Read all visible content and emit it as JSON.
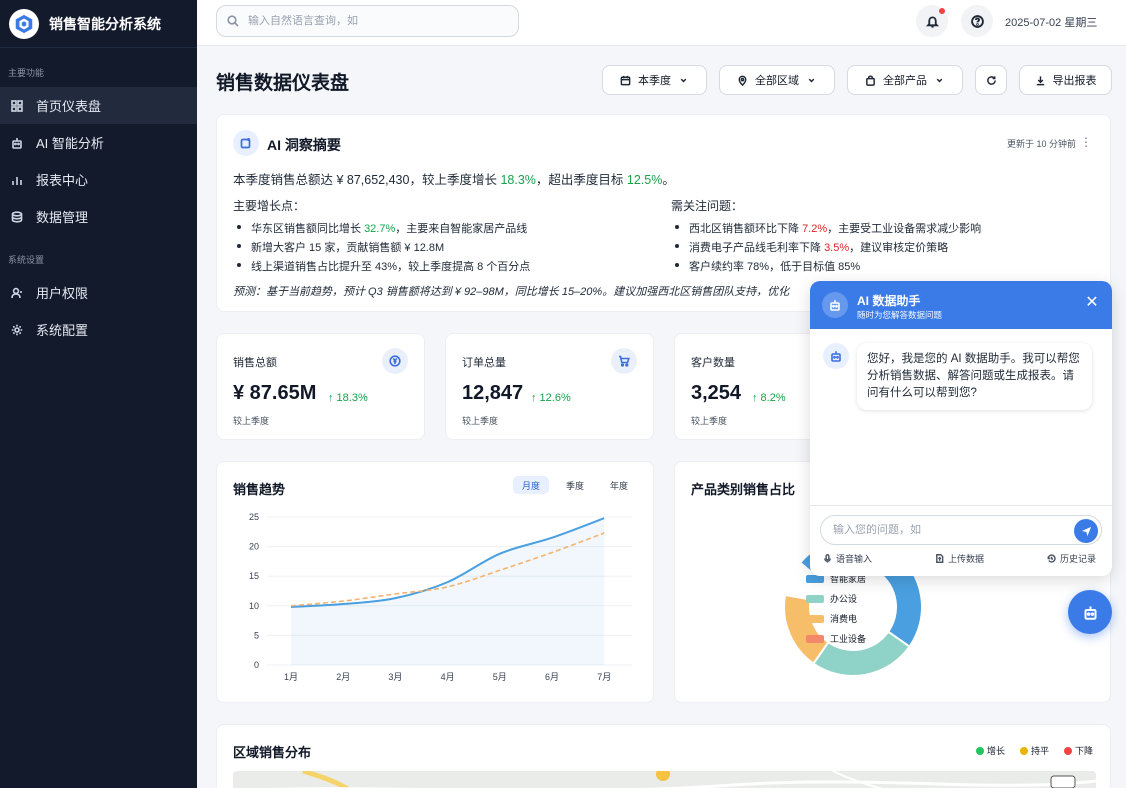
{
  "app": {
    "title": "销售智能分析系统"
  },
  "sidebar": {
    "section_main": "主要功能",
    "section_settings": "系统设置",
    "main_items": [
      {
        "label": "首页仪表盘",
        "icon": "grid-icon",
        "active": true
      },
      {
        "label": "AI 智能分析",
        "icon": "robot-icon"
      },
      {
        "label": "报表中心",
        "icon": "bar-chart-icon"
      },
      {
        "label": "数据管理",
        "icon": "database-icon"
      }
    ],
    "settings_items": [
      {
        "label": "用户权限",
        "icon": "user-icon"
      },
      {
        "label": "系统配置",
        "icon": "gear-icon"
      }
    ]
  },
  "topbar": {
    "search_placeholder": "输入自然语言查询，如",
    "date": "2025-07-02  星期三"
  },
  "header": {
    "title": "销售数据仪表盘",
    "filter_period": "本季度",
    "filter_region": "全部区域",
    "filter_product": "全部产品",
    "export_label": "导出报表"
  },
  "ai_summary": {
    "title": "AI 洞察摘要",
    "updated": "更新于 10 分钟前",
    "main_prefix": "本季度销售总额达 ¥ 87,652,430，较上季度增长 ",
    "main_growth": "18.3%",
    "main_middle": "，超出季度目标 ",
    "main_target": "12.5%",
    "main_suffix": "。",
    "growth_title": "主要增长点：",
    "growth_1_pre": "华东区销售额同比增长 ",
    "growth_1_val": "32.7%",
    "growth_1_post": "，主要来自智能家居产品线",
    "growth_2": "新增大客户 15 家，贡献销售额 ¥ 12.8M",
    "growth_3": "线上渠道销售占比提升至 43%，较上季度提高 8 个百分点",
    "issues_title": "需关注问题：",
    "issue_1_pre": "西北区销售额环比下降 ",
    "issue_1_val": "7.2%",
    "issue_1_post": "，主要受工业设备需求减少影响",
    "issue_2_pre": "消费电子产品线毛利率下降 ",
    "issue_2_val": "3.5%",
    "issue_2_post": "，建议审核定价策略",
    "issue_3": "客户续约率 78%，低于目标值 85%",
    "forecast": "预测：基于当前趋势，预计 Q3 销售额将达到 ¥ 92–98M，同比增长 15–20%。建议加强西北区销售团队支持，优化"
  },
  "kpis": [
    {
      "label": "销售总额",
      "value": "¥ 87.65M",
      "change": "↑ 18.3%",
      "sub": "较上季度",
      "icon": "currency-icon"
    },
    {
      "label": "订单总量",
      "value": "12,847",
      "change": "↑ 12.6%",
      "sub": "较上季度",
      "icon": "cart-icon"
    },
    {
      "label": "客户数量",
      "value": "3,254",
      "change": "↑ 8.2%",
      "sub": "较上季度"
    }
  ],
  "trend": {
    "title": "销售趋势",
    "tabs": [
      "月度",
      "季度",
      "年度"
    ],
    "active_tab": "月度"
  },
  "category": {
    "title": "产品类别销售占比",
    "legend": [
      "智能家居",
      "办公设",
      "消费电",
      "工业设备"
    ]
  },
  "regional": {
    "title": "区域销售分布",
    "legend": [
      "增长",
      "持平",
      "下降"
    ],
    "colors": [
      "#22c55e",
      "#eab308",
      "#ef4444"
    ]
  },
  "assistant": {
    "title": "AI 数据助手",
    "subtitle": "随时为您解答数据问题",
    "message": "您好，我是您的 AI 数据助手。我可以帮您分析销售数据、解答问题或生成报表。请问有什么可以帮到您?",
    "input_placeholder": "输入您的问题，如",
    "tool_voice": "语音输入",
    "tool_upload": "上传数据",
    "tool_history": "历史记录"
  },
  "chart_data": [
    {
      "type": "line",
      "x": [
        "1月",
        "2月",
        "3月",
        "4月",
        "5月",
        "6月",
        "7月"
      ],
      "series": [
        {
          "values": [
            9.8,
            10.3,
            11.3,
            14.0,
            18.8,
            21.5,
            24.8
          ],
          "style": "solid-area",
          "color": "#4a9fe0"
        },
        {
          "values": [
            10.0,
            10.8,
            12.0,
            13.2,
            16.0,
            19.0,
            22.3
          ],
          "style": "dashed",
          "color": "#f5b26b"
        }
      ],
      "yticks": [
        0,
        5,
        10,
        15,
        20,
        25
      ],
      "ylim": [
        0,
        25
      ],
      "grid": true
    },
    {
      "type": "pie",
      "categories": [
        "智能家居",
        "办公设",
        "消费电",
        "工业设备"
      ],
      "colors": [
        "#4a9fe0",
        "#8fd3c8",
        "#f7be6a",
        "#f4896a"
      ]
    }
  ]
}
